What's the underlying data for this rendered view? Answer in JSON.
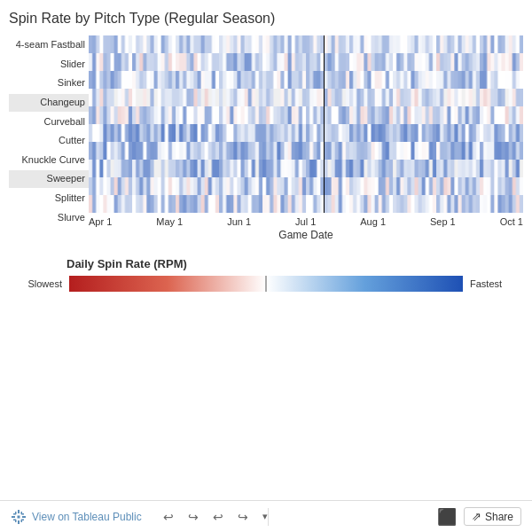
{
  "title": "Spin Rate by Pitch Type (Regular Season)",
  "pitchTypes": [
    {
      "label": "4-seam Fastball",
      "shaded": false
    },
    {
      "label": "Slider",
      "shaded": false
    },
    {
      "label": "Sinker",
      "shaded": false
    },
    {
      "label": "Changeup",
      "shaded": true
    },
    {
      "label": "Curveball",
      "shaded": false
    },
    {
      "label": "Cutter",
      "shaded": false
    },
    {
      "label": "Knuckle Curve",
      "shaded": false
    },
    {
      "label": "Sweeper",
      "shaded": true
    },
    {
      "label": "Splitter",
      "shaded": false
    },
    {
      "label": "Slurve",
      "shaded": false
    }
  ],
  "xLabels": [
    "Apr 1",
    "May 1",
    "Jun 1",
    "Jul 1",
    "Aug 1",
    "Sep 1",
    "Oct 1"
  ],
  "xAxisTitle": "Game Date",
  "verticalLinePos": 0.54,
  "legend": {
    "title": "Daily Spin Rate (RPM)",
    "slowLabel": "Slowest",
    "fastLabel": "Fastest"
  },
  "footer": {
    "tableauLabel": "View on Tableau Public",
    "shareLabel": "Share",
    "undoIcon": "↩",
    "redoIcon": "↪",
    "undoIcon2": "↩",
    "redoIcon2": "↪"
  }
}
